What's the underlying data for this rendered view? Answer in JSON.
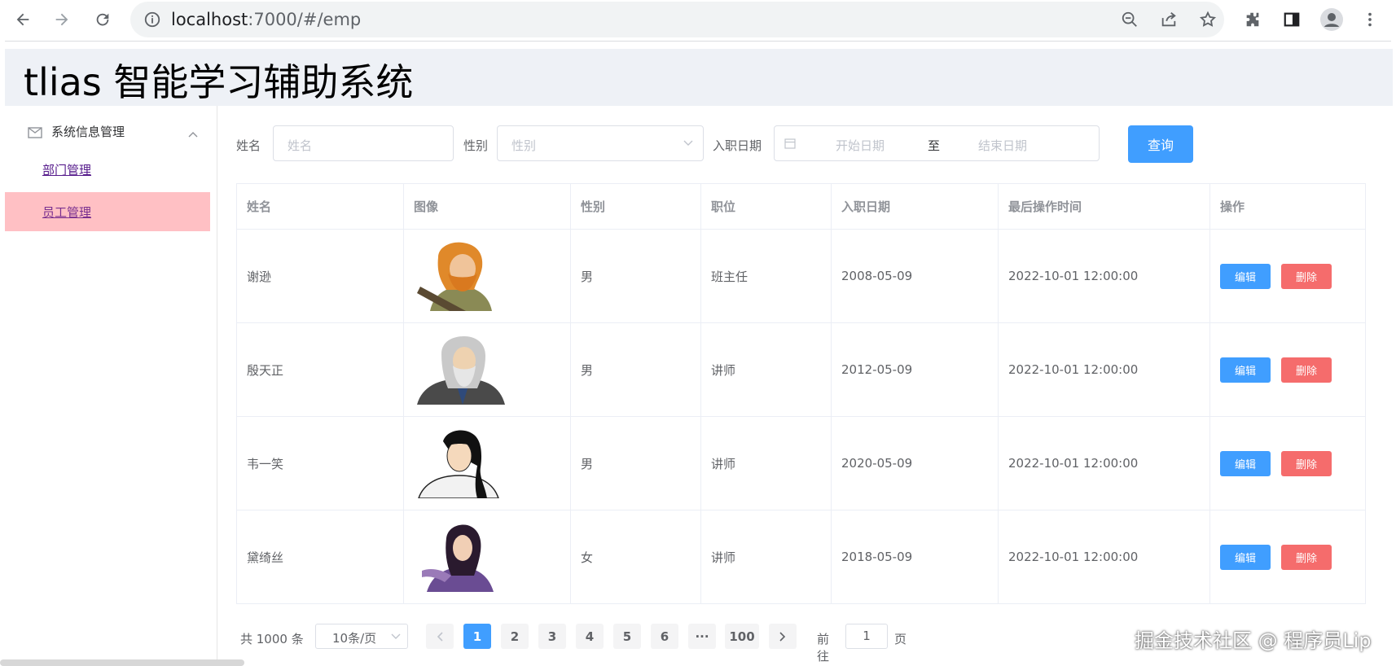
{
  "browser": {
    "url_host": "localhost",
    "url_rest": ":7000/#/emp",
    "icons": [
      "back-icon",
      "forward-icon",
      "reload-icon",
      "info-icon",
      "zoom-out-icon",
      "share-icon",
      "star-icon",
      "extensions-icon",
      "sidepanel-icon",
      "profile-icon",
      "menu-icon"
    ]
  },
  "app": {
    "title": "tlias 智能学习辅助系统"
  },
  "sidebar": {
    "group_label": "系统信息管理",
    "items": [
      {
        "label": "部门管理",
        "active": false
      },
      {
        "label": "员工管理",
        "active": true
      }
    ]
  },
  "search": {
    "name_label": "姓名",
    "name_placeholder": "姓名",
    "gender_label": "性别",
    "gender_placeholder": "性别",
    "date_label": "入职日期",
    "start_placeholder": "开始日期",
    "range_separator": "至",
    "end_placeholder": "结束日期",
    "query_button": "查询"
  },
  "table": {
    "headers": [
      "姓名",
      "图像",
      "性别",
      "职位",
      "入职日期",
      "最后操作时间",
      "操作"
    ],
    "rows": [
      {
        "name": "谢逊",
        "gender": "男",
        "job": "班主任",
        "entry_date": "2008-05-09",
        "update_time": "2022-10-01 12:00:00"
      },
      {
        "name": "殷天正",
        "gender": "男",
        "job": "讲师",
        "entry_date": "2012-05-09",
        "update_time": "2022-10-01 12:00:00"
      },
      {
        "name": "韦一笑",
        "gender": "男",
        "job": "讲师",
        "entry_date": "2020-05-09",
        "update_time": "2022-10-01 12:00:00"
      },
      {
        "name": "黛绮丝",
        "gender": "女",
        "job": "讲师",
        "entry_date": "2018-05-09",
        "update_time": "2022-10-01 12:00:00"
      }
    ],
    "edit_label": "编辑",
    "delete_label": "删除"
  },
  "pagination": {
    "total_text": "共 1000 条",
    "page_size": "10条/页",
    "pages": [
      "1",
      "2",
      "3",
      "4",
      "5",
      "6",
      "···",
      "100"
    ],
    "current_page": "1",
    "goto_label": "前往",
    "goto_value": "1",
    "page_unit": "页"
  },
  "watermark": "掘金技术社区 @ 程序员Lip",
  "colors": {
    "primary": "#409eff",
    "danger": "#f56c6c",
    "active_menu": "#ffc0c4",
    "header_bg": "#eef1f6"
  }
}
